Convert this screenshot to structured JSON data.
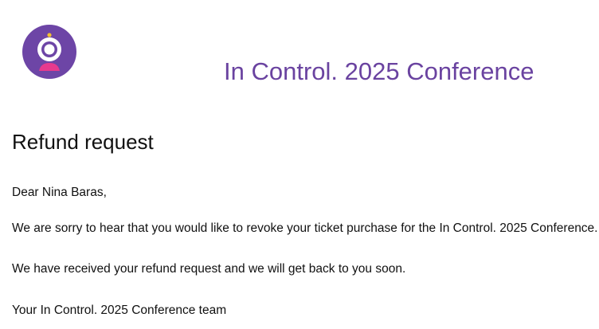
{
  "header": {
    "logo_icon": "conference-camera-logo-icon",
    "conference_title": "In Control. 2025 Conference"
  },
  "colors": {
    "brand_purple": "#6a43a0",
    "logo_circle": "#6d45a6",
    "logo_base": "#e63a8e",
    "logo_dot": "#f2c230"
  },
  "email": {
    "heading": "Refund request",
    "greeting": "Dear Nina Baras,",
    "paragraph_1": "We are sorry to hear that you would like to revoke your ticket purchase for the In Control. 2025 Conference.",
    "paragraph_2": "We have received your refund request and we will get back to you soon.",
    "signature": "Your In Control. 2025 Conference team"
  }
}
